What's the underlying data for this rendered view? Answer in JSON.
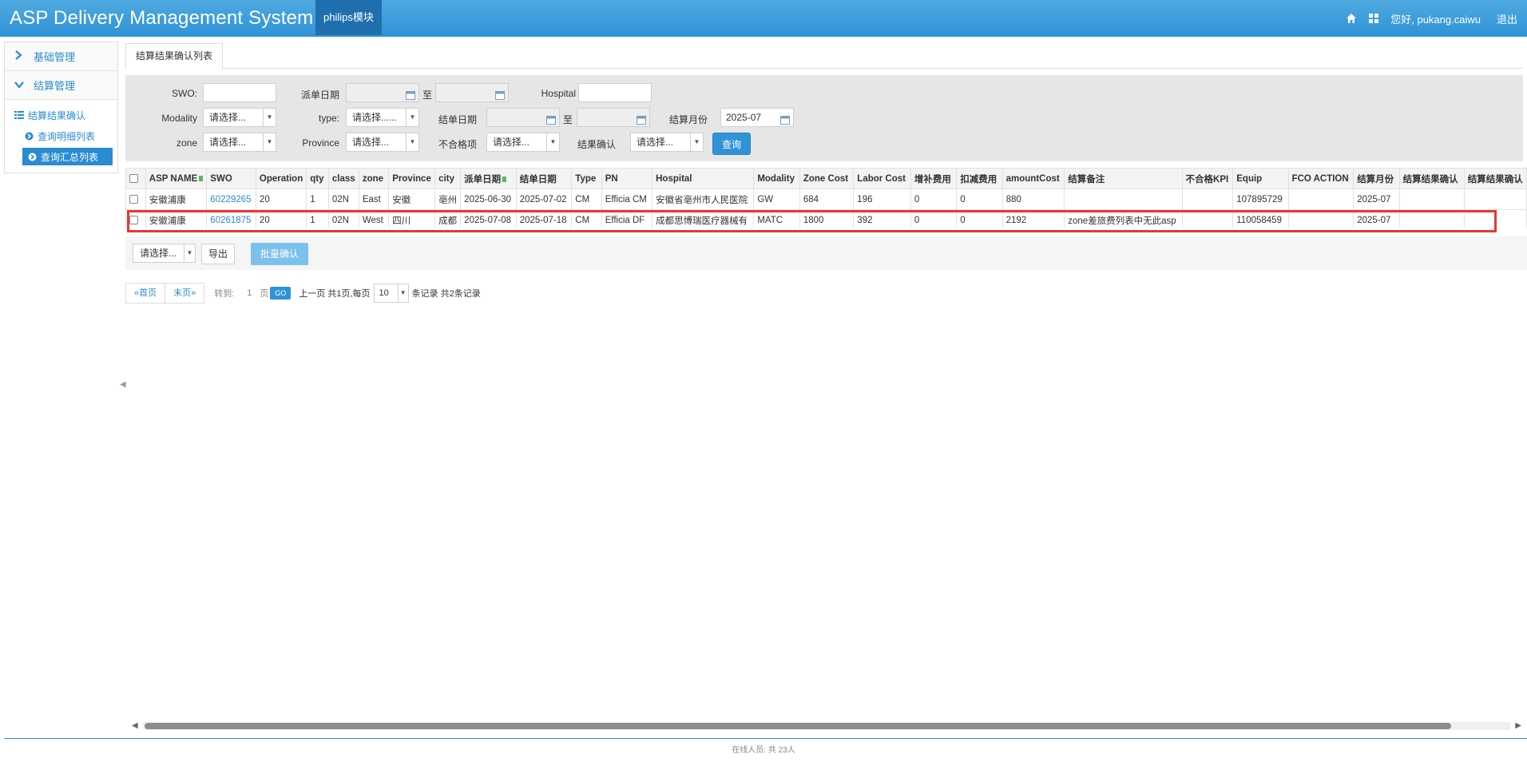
{
  "header": {
    "app_title": "ASP Delivery Management System",
    "module_tab": "philips模块",
    "greeting": "您好, pukang.caiwu",
    "logout": "退出",
    "icons": [
      "home-icon",
      "grid-icon"
    ]
  },
  "sidebar": {
    "groups": [
      {
        "label": "基础管理",
        "icon": "chevron-right-icon"
      },
      {
        "label": "结算管理",
        "icon": "chevron-down-icon"
      }
    ],
    "items": [
      {
        "label": "结算结果确认",
        "icon": "list-icon"
      },
      {
        "label": "查询明细列表",
        "icon": "circle-arrow-icon"
      },
      {
        "label": "查询汇总列表",
        "icon": "circle-arrow-icon",
        "active": true
      }
    ]
  },
  "tabs": {
    "active": "结算结果确认列表"
  },
  "filters": {
    "swo_label": "SWO:",
    "swo_value": "",
    "dispatch_date_label": "派单日期",
    "to_label": "至",
    "hospital_label": "Hospital",
    "modality_label": "Modality",
    "modality_value": "请选择...",
    "type_label": "type:",
    "type_value": "请选择......",
    "close_date_label": "结单日期",
    "settle_month_label": "结算月份",
    "settle_month_value": "2025-07",
    "zone_label": "zone",
    "zone_value": "请选择...",
    "province_label": "Province",
    "province_value": "请选择...",
    "unqualified_label": "不合格项",
    "unqualified_value": "请选择...",
    "confirm_label": "结果确认",
    "confirm_value": "请选择...",
    "query_button": "查询"
  },
  "table": {
    "columns": [
      "ASP NAME",
      "SWO",
      "Operation",
      "qty",
      "class",
      "zone",
      "Province",
      "city",
      "派单日期",
      "结单日期",
      "Type",
      "PN",
      "Hospital",
      "Modality",
      "Zone Cost",
      "Labor Cost",
      "增补费用",
      "扣减费用",
      "amountCost",
      "结算备注",
      "不合格KPI",
      "Equip",
      "FCO ACTION",
      "结算月份",
      "结算结果确认",
      "结算结果确认"
    ],
    "rows": [
      [
        "安徽浦康",
        "60229265",
        "20",
        "1",
        "02N",
        "East",
        "安徽",
        "亳州",
        "2025-06-30",
        "2025-07-02",
        "CM",
        "Efficia CM",
        "安徽省亳州市人民医院",
        "GW",
        "684",
        "196",
        "0",
        "0",
        "880",
        "",
        "",
        "107895729",
        "",
        "2025-07",
        "",
        ""
      ],
      [
        "安徽浦康",
        "60261875",
        "20",
        "1",
        "02N",
        "West",
        "四川",
        "成都",
        "2025-07-08",
        "2025-07-18",
        "CM",
        "Efficia DF",
        "成都思博瑞医疗器械有",
        "MATC",
        "1800",
        "392",
        "0",
        "0",
        "2192",
        "zone差旅费列表中无此asp",
        "",
        "110058459",
        "",
        "2025-07",
        "",
        ""
      ]
    ]
  },
  "actions": {
    "select_value": "请选择...",
    "export_button": "导出",
    "batch_confirm_button": "批量确认"
  },
  "pager": {
    "first": "«首页",
    "last": "末页»",
    "goto_label": "转到:",
    "page_value": "1",
    "page_unit": "页",
    "go_button": "GO",
    "summary1": "上一页 共1页,每页",
    "page_size": "10",
    "summary2": "条记录 共2条记录"
  },
  "footer": {
    "online": "在线人员: 共 23人"
  }
}
